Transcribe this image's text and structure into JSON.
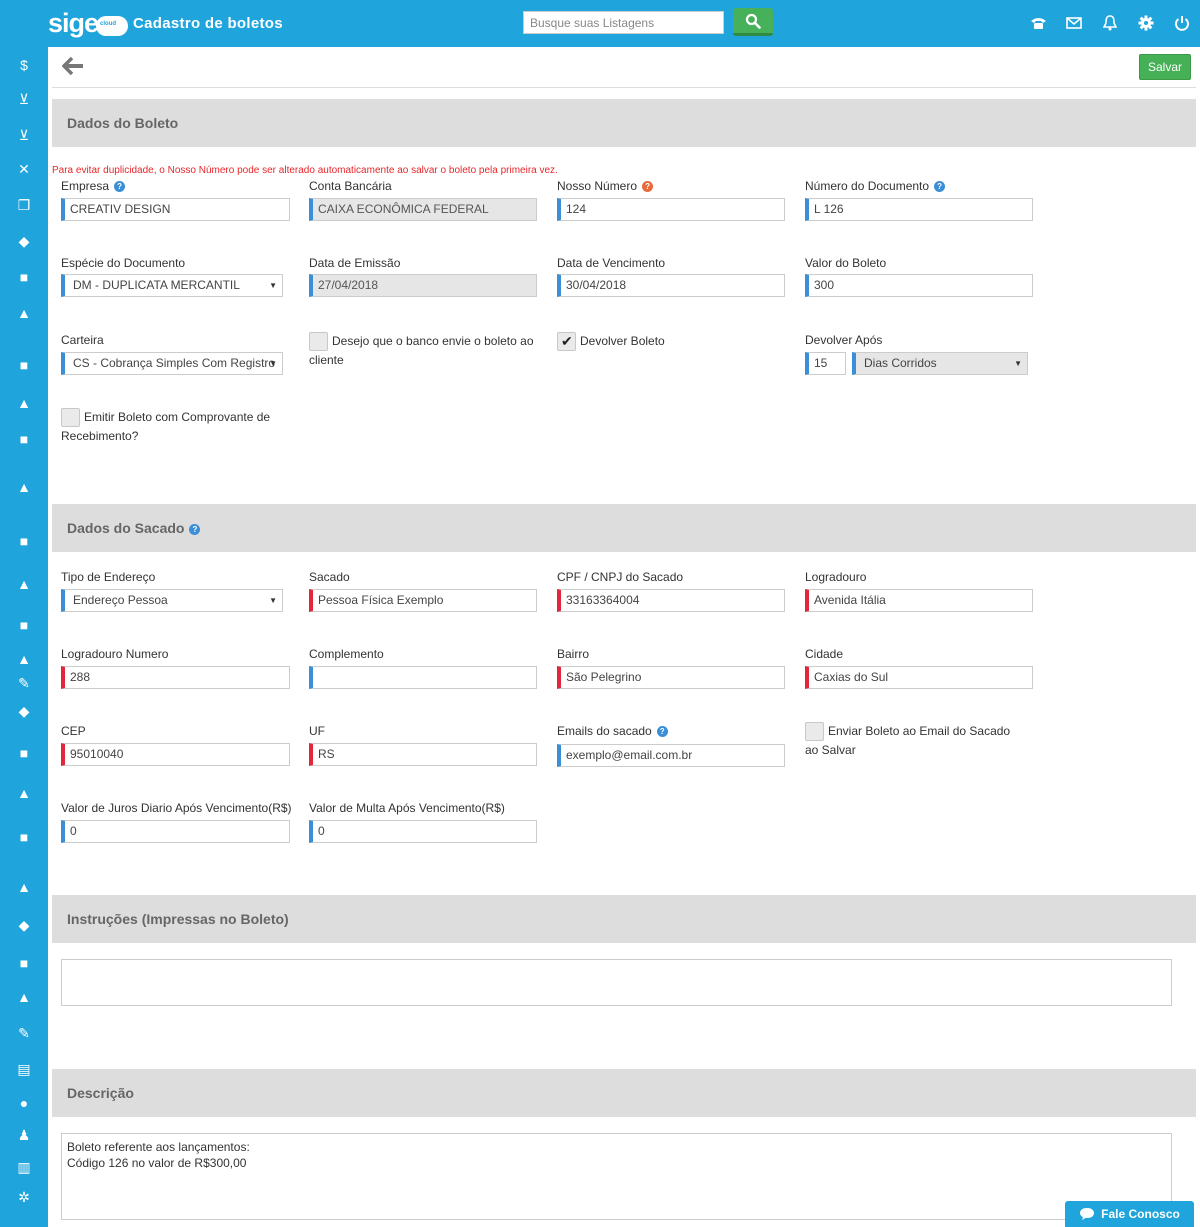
{
  "app": {
    "logo": "sige",
    "logo_badge": "cloud",
    "title": "Cadastro de boletos"
  },
  "search": {
    "placeholder": "Busque suas Listagens"
  },
  "top_icons": [
    "phone-icon",
    "mail-icon",
    "bell-icon",
    "gear-icon",
    "power-icon"
  ],
  "sidebar_icons": [
    "money-icon",
    "cart-icon",
    "cart-icon",
    "tools-icon",
    "copy-icon",
    "box-icon",
    "truck-icon",
    "car-icon",
    "truck-icon",
    "car-icon",
    "truck-icon",
    "car-icon",
    "truck-icon",
    "car-icon",
    "truck-icon",
    "car-icon",
    "pen-icon",
    "box-icon",
    "truck-icon",
    "car-icon",
    "truck-icon",
    "car-icon",
    "box-icon",
    "truck-icon",
    "car-icon",
    "pen-icon",
    "id-card-icon",
    "clock-icon",
    "people-icon",
    "barcode-icon",
    "gears-icon",
    "chart-icon"
  ],
  "toolbar": {
    "save_label": "Salvar"
  },
  "boleto": {
    "section_title": "Dados do Boleto",
    "warning": "Para evitar duplicidade, o Nosso Número pode ser alterado automaticamente ao salvar o boleto pela primeira vez.",
    "empresa_label": "Empresa",
    "empresa_value": "CREATIV DESIGN",
    "conta_label": "Conta Bancária",
    "conta_value": "CAIXA ECONÔMICA FEDERAL",
    "nosso_label": "Nosso Número",
    "nosso_value": "124",
    "numdoc_label": "Número do Documento",
    "numdoc_value": "L 126",
    "especie_label": "Espécie do Documento",
    "especie_value": "DM - DUPLICATA MERCANTIL",
    "emissao_label": "Data de Emissão",
    "emissao_value": "27/04/2018",
    "vencimento_label": "Data de Vencimento",
    "vencimento_value": "30/04/2018",
    "valor_label": "Valor do Boleto",
    "valor_value": "300",
    "carteira_label": "Carteira",
    "carteira_value": "CS - Cobrança Simples Com Registro",
    "banco_envie_label": "Desejo que o banco envie o boleto ao cliente",
    "devolver_label": "Devolver Boleto",
    "devolver_apos_label": "Devolver Após",
    "devolver_apos_value": "15",
    "dias_value": "Dias Corridos",
    "comprovante_label": "Emitir Boleto com Comprovante de Recebimento?"
  },
  "sacado": {
    "section_title": "Dados do Sacado",
    "tipo_label": "Tipo de Endereço",
    "tipo_value": "Endereço Pessoa",
    "sacado_label": "Sacado",
    "sacado_value": "Pessoa Física Exemplo",
    "cpf_label": "CPF / CNPJ do Sacado",
    "cpf_value": "33163364004",
    "logradouro_label": "Logradouro",
    "logradouro_value": "Avenida Itália",
    "numero_label": "Logradouro Numero",
    "numero_value": "288",
    "complemento_label": "Complemento",
    "complemento_value": "",
    "bairro_label": "Bairro",
    "bairro_value": "São Pelegrino",
    "cidade_label": "Cidade",
    "cidade_value": "Caxias do Sul",
    "cep_label": "CEP",
    "cep_value": "95010040",
    "uf_label": "UF",
    "uf_value": "RS",
    "emails_label": "Emails do sacado",
    "emails_value": "exemplo@email.com.br",
    "enviar_email_label": "Enviar Boleto ao Email do Sacado ao Salvar",
    "juros_label": "Valor de Juros Diario Após Vencimento(R$)",
    "juros_value": "0",
    "multa_label": "Valor de Multa Após Vencimento(R$)",
    "multa_value": "0"
  },
  "instrucoes": {
    "section_title": "Instruções (Impressas no Boleto)",
    "value": ""
  },
  "descricao": {
    "section_title": "Descrição",
    "value": "Boleto referente aos lançamentos:\nCódigo 126 no valor de R$300,00"
  },
  "chat": {
    "label": "Fale Conosco"
  }
}
